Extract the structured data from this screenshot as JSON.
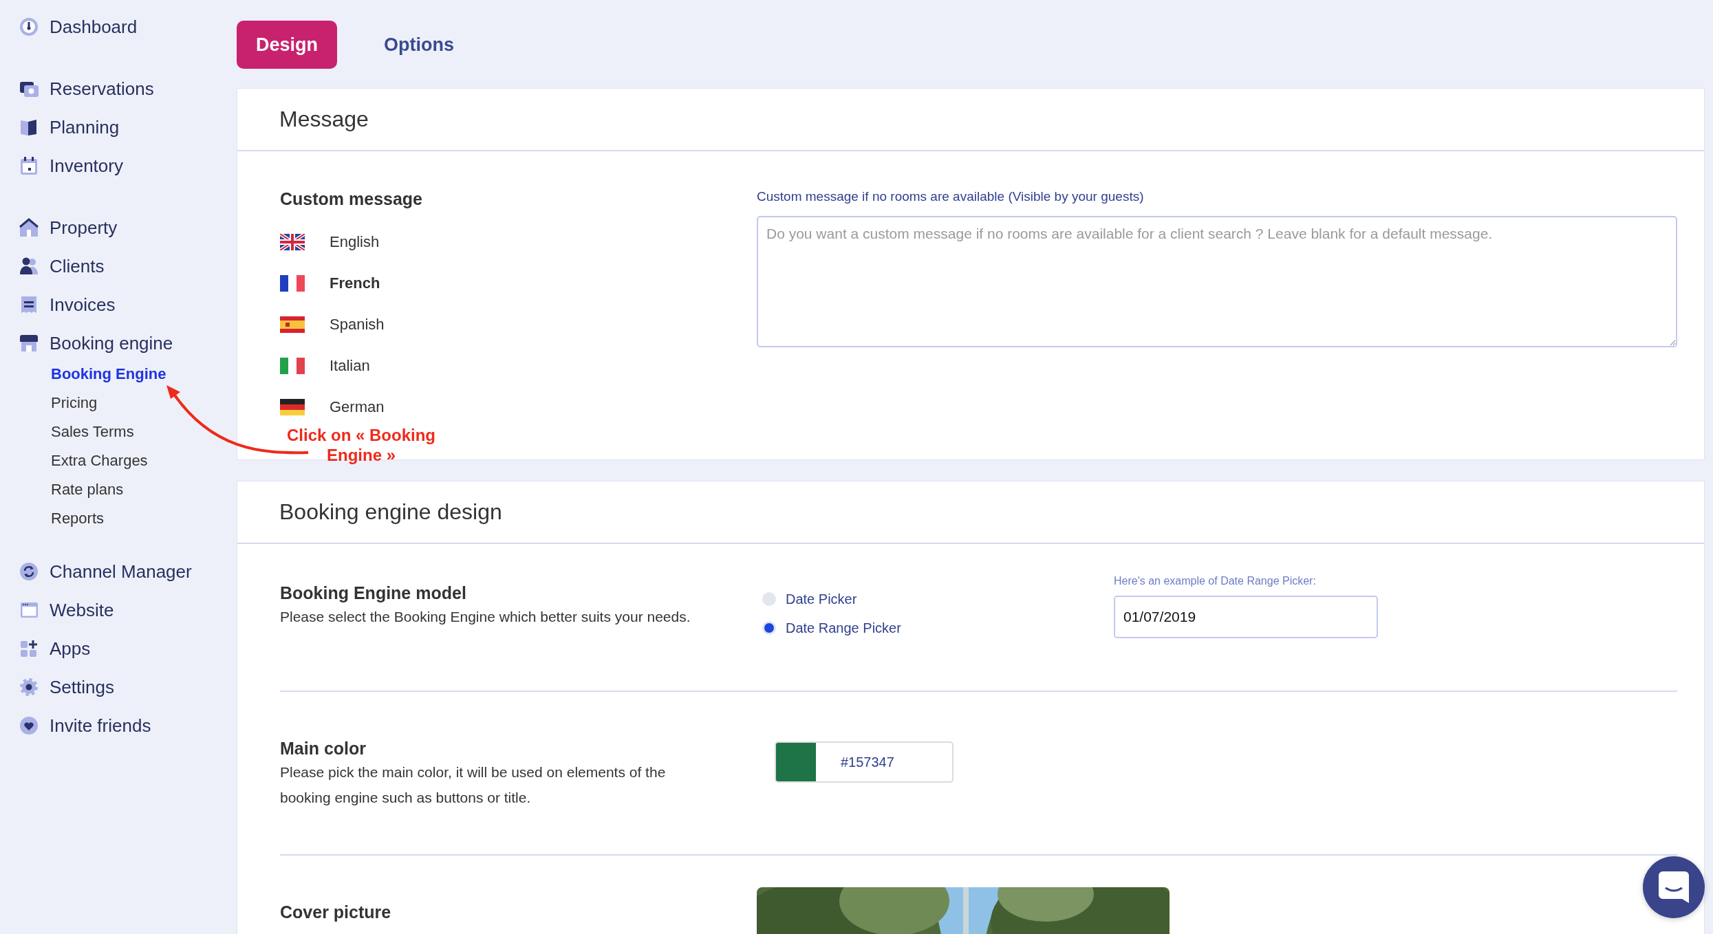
{
  "sidebar": {
    "groups": [
      [
        {
          "label": "Dashboard"
        }
      ],
      [
        {
          "label": "Reservations"
        },
        {
          "label": "Planning"
        },
        {
          "label": "Inventory"
        }
      ],
      [
        {
          "label": "Property"
        },
        {
          "label": "Clients"
        },
        {
          "label": "Invoices"
        },
        {
          "label": "Booking engine",
          "expanded": true,
          "children": [
            {
              "label": "Booking Engine",
              "selected": true
            },
            {
              "label": "Pricing",
              "selected": false
            },
            {
              "label": "Sales Terms",
              "selected": false
            },
            {
              "label": "Extra Charges",
              "selected": false
            },
            {
              "label": "Rate plans",
              "selected": false
            },
            {
              "label": "Reports",
              "selected": false
            }
          ]
        }
      ],
      [
        {
          "label": "Channel Manager"
        },
        {
          "label": "Website"
        },
        {
          "label": "Apps"
        },
        {
          "label": "Settings"
        },
        {
          "label": "Invite friends"
        }
      ]
    ]
  },
  "tabs": [
    {
      "label": "Design",
      "selected": true
    },
    {
      "label": "Options",
      "selected": false
    }
  ],
  "message_card": {
    "title": "Message",
    "languages_title": "Custom message",
    "languages": [
      {
        "name": "English",
        "selected": false
      },
      {
        "name": "French",
        "selected": true
      },
      {
        "name": "Spanish",
        "selected": false
      },
      {
        "name": "Italian",
        "selected": false
      },
      {
        "name": "German",
        "selected": false
      }
    ],
    "field_label": "Custom message if no rooms are available (Visible by your guests)",
    "placeholder": "Do you want a custom message if no rooms are available for a client search ? Leave blank for a default message."
  },
  "design_card": {
    "title": "Booking engine design",
    "rows": [
      {
        "kind": "radio",
        "title": "Booking Engine model",
        "description": "Please select the Booking Engine which better suits your needs.",
        "options": [
          {
            "label": "Date Picker",
            "selected": false
          },
          {
            "label": "Date Range Picker",
            "selected": true
          }
        ],
        "example_label": "Here's an example of Date Range Picker:",
        "example_value": "01/07/2019"
      },
      {
        "kind": "color",
        "title": "Main color",
        "description": "Please pick the main color, it will be used on elements of the booking engine such as buttons or title.",
        "value": "#157347",
        "color": "#1e7347"
      },
      {
        "kind": "picture",
        "title": "Cover picture"
      }
    ]
  },
  "annotation": {
    "text": "Click on « Booking Engine »"
  }
}
